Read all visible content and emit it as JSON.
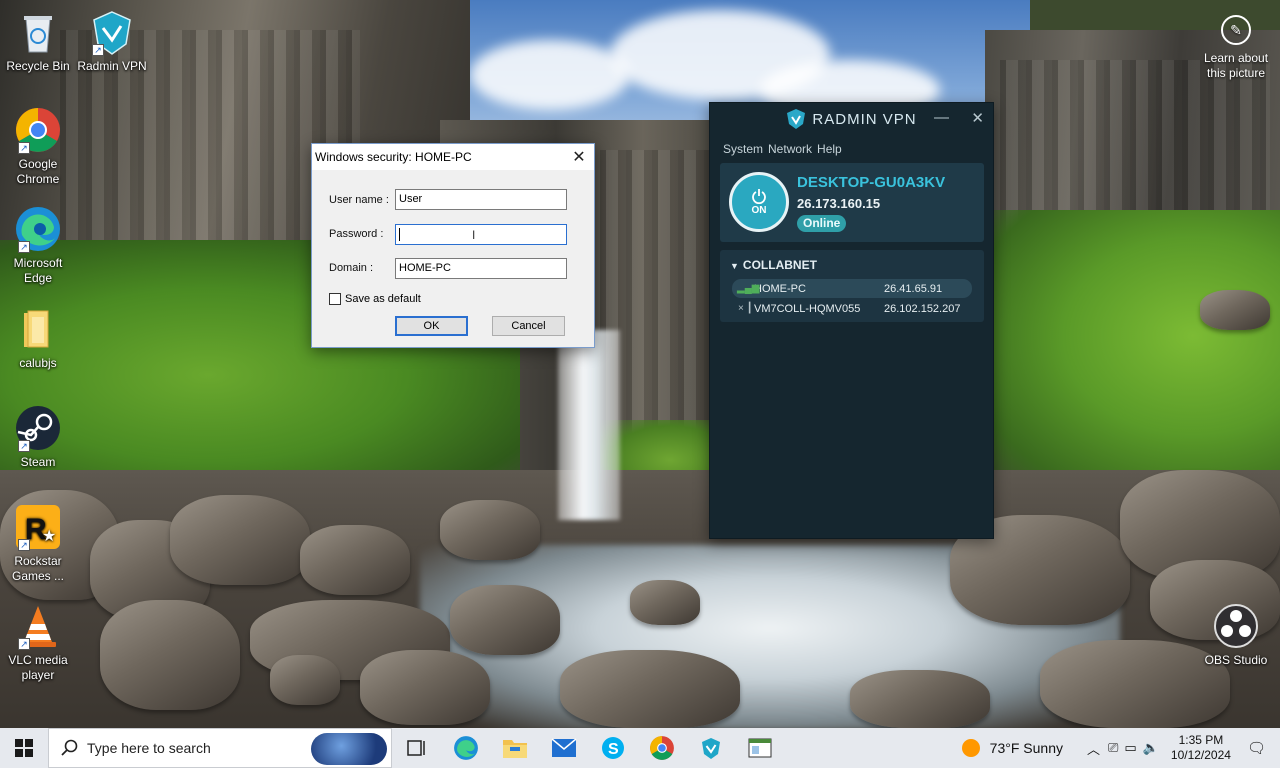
{
  "desktop": {
    "icons_left": [
      {
        "label": "Recycle Bin",
        "icon": "recycle-bin-icon"
      },
      {
        "label": "Google Chrome",
        "icon": "chrome-icon"
      },
      {
        "label": "Microsoft Edge",
        "icon": "edge-icon"
      },
      {
        "label": "calubjs",
        "icon": "folder-icon"
      },
      {
        "label": "Steam",
        "icon": "steam-icon"
      },
      {
        "label": "Rockstar Games ...",
        "icon": "rockstar-icon"
      },
      {
        "label": "VLC media player",
        "icon": "vlc-icon"
      }
    ],
    "icon_top": {
      "label": "Radmin VPN",
      "icon": "radmin-icon"
    },
    "learn_label": "Learn about this picture",
    "obs_label": "OBS Studio"
  },
  "dialog": {
    "title": "Windows security: HOME-PC",
    "username_label": "User name :",
    "username_value": "User",
    "password_label": "Password :",
    "password_value": "",
    "domain_label": "Domain :",
    "domain_value": "HOME-PC",
    "save_default": "Save as default",
    "ok": "OK",
    "cancel": "Cancel"
  },
  "vpn": {
    "brand": "RADMIN VPN",
    "menu": [
      "System",
      "Network",
      "Help"
    ],
    "hostname": "DESKTOP-GU0A3KV",
    "ip": "26.173.160.15",
    "power_label": "ON",
    "status": "Online",
    "network_name": "COLLABNET",
    "peers": [
      {
        "name": "HOME-PC",
        "ip": "26.41.65.91",
        "online": true
      },
      {
        "name": "VM7COLL-HQMV055",
        "ip": "26.102.152.207",
        "online": false
      }
    ],
    "accent": "#3ac2dc"
  },
  "taskbar": {
    "search_placeholder": "Type here to search",
    "weather": "73°F  Sunny",
    "time": "1:35 PM",
    "date": "10/12/2024"
  }
}
